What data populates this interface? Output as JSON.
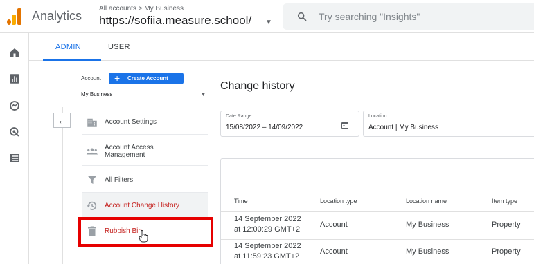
{
  "header": {
    "app_name": "Analytics",
    "breadcrumb": "All accounts > My Business",
    "property": "https://sofiia.measure.school/",
    "search_placeholder": "Try searching \"Insights\""
  },
  "tabs": [
    {
      "label": "ADMIN",
      "active": true
    },
    {
      "label": "USER",
      "active": false
    }
  ],
  "account": {
    "label": "Account",
    "create_button": "Create Account",
    "selected": "My Business"
  },
  "menu": [
    {
      "label": "Account Settings",
      "icon": "building-icon"
    },
    {
      "label": "Account Access Management",
      "icon": "people-icon"
    },
    {
      "label": "All Filters",
      "icon": "filter-icon"
    },
    {
      "label": "Account Change History",
      "icon": "history-icon",
      "active": true
    },
    {
      "label": "Rubbish Bin",
      "icon": "trash-icon"
    }
  ],
  "main": {
    "title": "Change history",
    "date_range_label": "Date Range",
    "date_range_value": "15/08/2022 – 14/09/2022",
    "location_label": "Location",
    "location_value": "Account | My Business"
  },
  "table": {
    "columns": [
      "Time",
      "Location type",
      "Location name",
      "Item type"
    ],
    "rows": [
      {
        "time_line1": "14 September 2022",
        "time_line2": "at 12:00:29 GMT+2",
        "location_type": "Account",
        "location_name": "My Business",
        "item_type": "Property"
      },
      {
        "time_line1": "14 September 2022",
        "time_line2": "at 11:59:23 GMT+2",
        "location_type": "Account",
        "location_name": "My Business",
        "item_type": "Property"
      }
    ]
  },
  "colors": {
    "accent": "#1a73e8",
    "active_text": "#c5221f",
    "highlight": "#e60000"
  }
}
